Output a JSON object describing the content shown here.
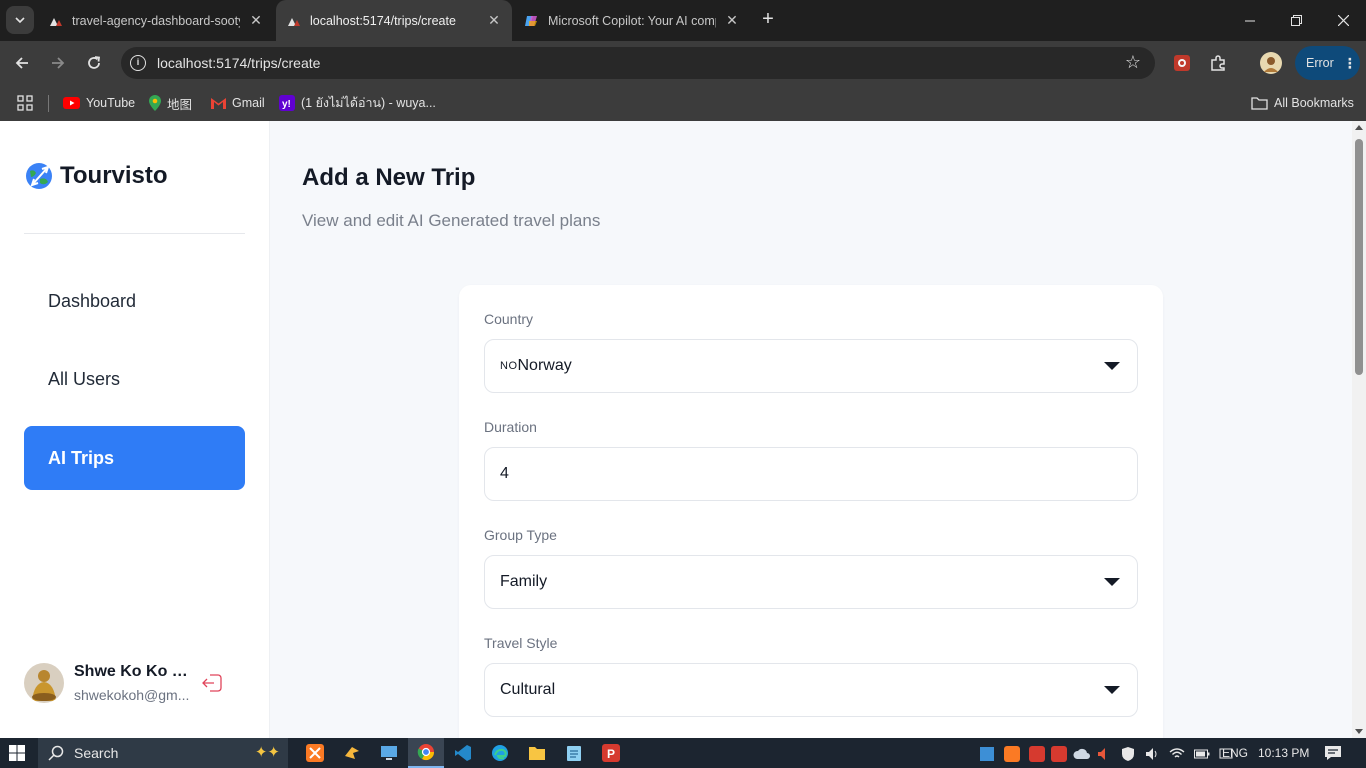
{
  "browser": {
    "tabs": [
      {
        "title": "travel-agency-dashboard-sooty",
        "active": false
      },
      {
        "title": "localhost:5174/trips/create",
        "active": true
      },
      {
        "title": "Microsoft Copilot: Your AI comp",
        "active": false
      }
    ],
    "url": "localhost:5174/trips/create",
    "error_label": "Error",
    "bookmarks": [
      "YouTube",
      "地图",
      "Gmail",
      "(1 ยังไม่ได้อ่าน) - wuya..."
    ],
    "all_bookmarks_label": "All Bookmarks"
  },
  "sidebar": {
    "brand": "Tourvisto",
    "items": [
      {
        "label": "Dashboard",
        "active": false
      },
      {
        "label": "All Users",
        "active": false
      },
      {
        "label": "AI Trips",
        "active": true
      }
    ],
    "user": {
      "name": "Shwe Ko Ko H...",
      "email": "shwekokoh@gm..."
    }
  },
  "main": {
    "title": "Add a New Trip",
    "subtitle": "View and edit AI Generated travel plans",
    "form": {
      "country": {
        "label": "Country",
        "flag": "NO",
        "value": "Norway"
      },
      "duration": {
        "label": "Duration",
        "value": "4"
      },
      "group_type": {
        "label": "Group Type",
        "value": "Family"
      },
      "travel_style": {
        "label": "Travel Style",
        "value": "Cultural"
      }
    }
  },
  "taskbar": {
    "search_label": "Search",
    "language": "ENG",
    "time": "10:13 PM"
  },
  "colors": {
    "accent": "#2f7cf6",
    "chrome_dark": "#1f1f1f",
    "toolbar": "#3c3c3c",
    "page_bg": "#f6f8fb"
  }
}
